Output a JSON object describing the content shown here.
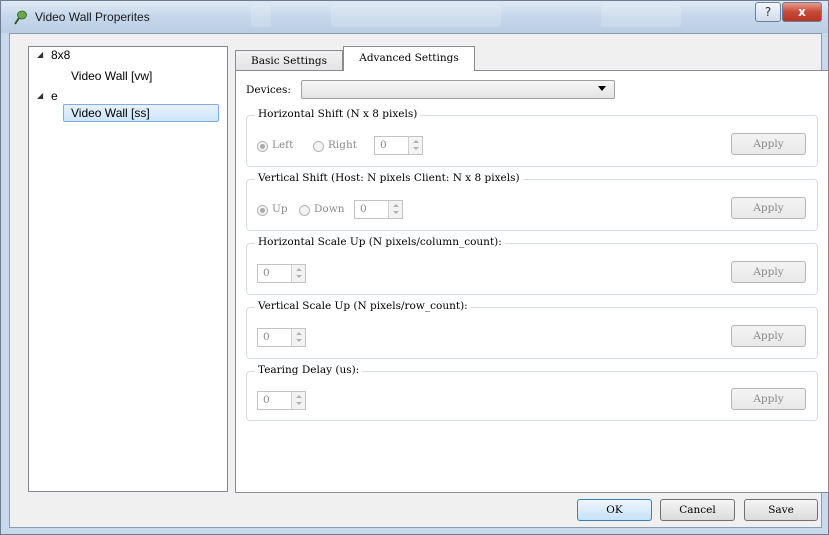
{
  "window": {
    "title": "Video Wall Properites",
    "help_glyph": "?",
    "close_glyph": "x"
  },
  "tree": {
    "nodes": [
      {
        "label": "8x8",
        "children": [
          {
            "label": "Video Wall [vw]"
          }
        ]
      },
      {
        "label": "e",
        "children": [
          {
            "label": "Video Wall [ss]",
            "selected": true
          }
        ]
      }
    ]
  },
  "tabs": [
    {
      "label": "Basic Settings"
    },
    {
      "label": "Advanced Settings",
      "active": true
    }
  ],
  "advanced": {
    "devices": {
      "label": "Devices:",
      "value": ""
    },
    "horizontal_shift": {
      "title": "Horizontal Shift (N x 8 pixels)",
      "option_left": "Left",
      "option_right": "Right",
      "selected": "Left",
      "value": "0",
      "apply_label": "Apply"
    },
    "vertical_shift": {
      "title": "Vertical Shift (Host: N pixels  Client: N x 8 pixels)",
      "option_up": "Up",
      "option_down": "Down",
      "selected": "Up",
      "value": "0",
      "apply_label": "Apply"
    },
    "horizontal_scale": {
      "title": "Horizontal Scale Up (N pixels/column_count):",
      "value": "0",
      "apply_label": "Apply"
    },
    "vertical_scale": {
      "title": "Vertical Scale Up (N pixels/row_count):",
      "value": "0",
      "apply_label": "Apply"
    },
    "tearing_delay": {
      "title": "Tearing Delay (us):",
      "value": "0",
      "apply_label": "Apply"
    }
  },
  "footer": {
    "ok_label": "OK",
    "cancel_label": "Cancel",
    "save_label": "Save"
  },
  "colors": {
    "titlebar": "#c7d8ec",
    "close": "#c74a36",
    "selection": "#cde4fa",
    "panel_bg": "#f0f0f0"
  }
}
